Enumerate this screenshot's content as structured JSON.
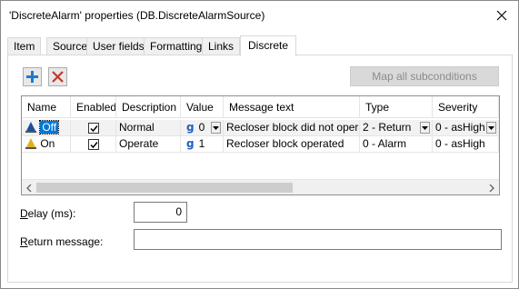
{
  "window": {
    "title": "'DiscreteAlarm' properties (DB.DiscreteAlarmSource)"
  },
  "tabs": [
    {
      "label": "Item"
    },
    {
      "label": "Source"
    },
    {
      "label": "User fields"
    },
    {
      "label": "Formatting"
    },
    {
      "label": "Links"
    },
    {
      "label": "Discrete"
    }
  ],
  "active_tab": "Discrete",
  "toolbar": {
    "add_icon": "plus-icon",
    "delete_icon": "x-icon",
    "map_button_label": "Map all subconditions"
  },
  "grid": {
    "columns": [
      "Name",
      "Enabled",
      "Description",
      "Value",
      "Message text",
      "Type",
      "Severity"
    ],
    "rows": [
      {
        "name": "Off",
        "enabled": true,
        "description": "Normal",
        "value_icon": "g",
        "value": "0",
        "message": "Recloser block did not operate",
        "type": "2 - Return",
        "severity": "0 - asHigh"
      },
      {
        "name": "On",
        "enabled": true,
        "description": "Operate",
        "value_icon": "g",
        "value": "1",
        "message": "Recloser block operated",
        "type": "0 - Alarm",
        "severity": "0 - asHigh"
      }
    ]
  },
  "fields": {
    "delay_label_pre": "",
    "delay_label_u": "D",
    "delay_label_post": "elay (ms):",
    "delay_value": "0",
    "return_label_pre": "",
    "return_label_u": "R",
    "return_label_post": "eturn message:",
    "return_value": ""
  },
  "colors": {
    "accent": "#0078d7",
    "add_icon": "#1f78d1",
    "delete_icon": "#c0392b"
  }
}
